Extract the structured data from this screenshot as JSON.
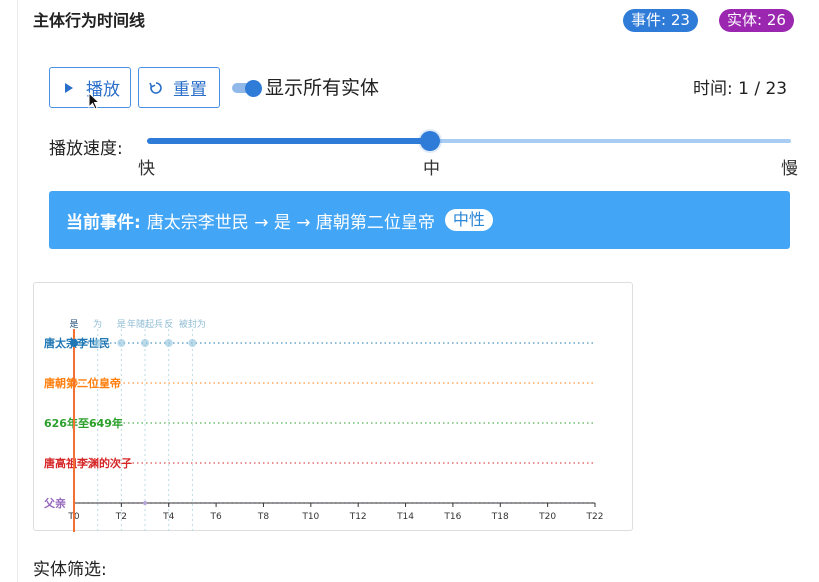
{
  "header": {
    "title": "主体行为时间线",
    "events_badge": "事件: 23",
    "entities_badge": "实体: 26"
  },
  "controls": {
    "play_label": "播放",
    "reset_label": "重置",
    "toggle_label": "显示所有实体",
    "toggle_on": true,
    "time_label": "时间: 1 / 23"
  },
  "speed": {
    "label": "播放速度:",
    "fast": "快",
    "medium": "中",
    "slow": "慢",
    "value": 0.44
  },
  "current_event": {
    "lead": "当前事件:",
    "text": "唐太宗李世民 → 是 → 唐朝第二位皇帝",
    "tag": "中性"
  },
  "chart_data": {
    "type": "scatter",
    "x_ticks": [
      "T0",
      "T2",
      "T4",
      "T6",
      "T8",
      "T10",
      "T12",
      "T14",
      "T16",
      "T18",
      "T20",
      "T22"
    ],
    "xlim": [
      0,
      22
    ],
    "current_time": 0,
    "entities": [
      {
        "name": "唐太宗李世民",
        "color": "#1f77b4"
      },
      {
        "name": "唐朝第二位皇帝",
        "color": "#ff7f0e"
      },
      {
        "name": "626年至649年",
        "color": "#2ca02c"
      },
      {
        "name": "唐高祖李渊的次子",
        "color": "#d62728"
      },
      {
        "name": "父亲",
        "color": "#9467bd"
      }
    ],
    "events": [
      {
        "t": 0,
        "entity": 0,
        "label": "是",
        "active": true
      },
      {
        "t": 1,
        "entity": 0,
        "label": "为",
        "active": false
      },
      {
        "t": 2,
        "entity": 0,
        "label": "是",
        "active": false
      },
      {
        "t": 3,
        "entity": 0,
        "label": "年随起兵",
        "active": false
      },
      {
        "t": 4,
        "entity": 0,
        "label": "反",
        "active": false
      },
      {
        "t": 5,
        "entity": 0,
        "label": "被封为",
        "active": false
      }
    ]
  },
  "filter": {
    "label": "实体筛选:"
  }
}
